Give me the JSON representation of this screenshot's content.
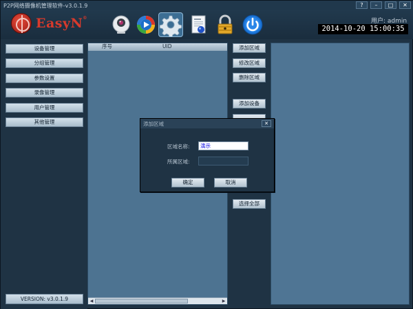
{
  "window": {
    "title": "P2P网络摄像机管理软件-v3.0.1.9",
    "help_label": "?",
    "minimize_label": "–",
    "maximize_label": "□",
    "close_label": "✕"
  },
  "header": {
    "logo_text": "EasyN",
    "logo_mark": "®",
    "user_label": "用户: admin",
    "datetime": "2014-10-20 15:00:35",
    "toolbar_icons": [
      "camera-icon",
      "play-icon",
      "settings-icon",
      "document-icon",
      "lock-icon",
      "power-icon"
    ],
    "active_tool": "settings-icon"
  },
  "sidebar": {
    "items": [
      {
        "label": "设备管理"
      },
      {
        "label": "分组管理"
      },
      {
        "label": "参数设置"
      },
      {
        "label": "录像管理"
      },
      {
        "label": "用户管理"
      },
      {
        "label": "其他管理"
      }
    ],
    "version": "VERSION: v3.0.1.9"
  },
  "list": {
    "columns": [
      "序号",
      "UID"
    ],
    "rows": []
  },
  "actions": {
    "buttons": [
      {
        "label": "添加区域"
      },
      {
        "label": "修改区域"
      },
      {
        "label": "删除区域"
      },
      {
        "label": "添加设备"
      },
      {
        "label": "选择全部"
      }
    ]
  },
  "dialog": {
    "title": "添加区域",
    "area_name_label": "区域名称:",
    "area_name_value": "演示",
    "parent_area_label": "所属区域:",
    "parent_area_value": "",
    "ok_label": "确定",
    "cancel_label": "取消"
  },
  "colors": {
    "accent": "#3c6e94",
    "panel": "#4d7391",
    "background": "#1f3344",
    "logo_red": "#d83a2c"
  }
}
